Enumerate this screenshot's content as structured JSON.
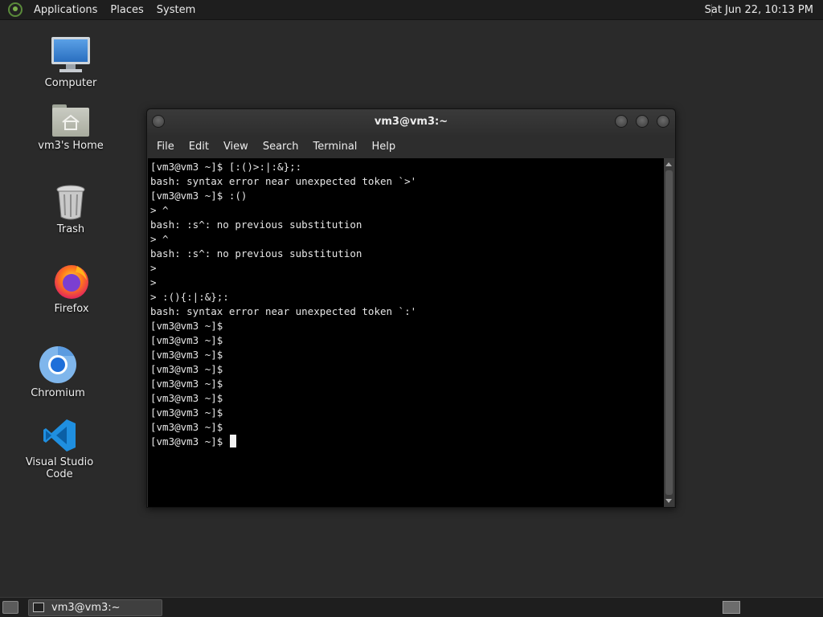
{
  "top_panel": {
    "menus": [
      "Applications",
      "Places",
      "System"
    ],
    "clock": "Sat Jun 22, 10:13 PM"
  },
  "desktop_icons": [
    {
      "label": "Computer",
      "icon": "computer-icon"
    },
    {
      "label": "vm3's Home",
      "icon": "home-folder-icon"
    },
    {
      "label": "Trash",
      "icon": "trash-icon"
    },
    {
      "label": "Firefox",
      "icon": "firefox-icon"
    },
    {
      "label": "Chromium",
      "icon": "chromium-icon"
    },
    {
      "label": "Visual Studio Code",
      "icon": "vscode-icon"
    }
  ],
  "terminal": {
    "title": "vm3@vm3:~",
    "menu": [
      "File",
      "Edit",
      "View",
      "Search",
      "Terminal",
      "Help"
    ],
    "lines": [
      "[vm3@vm3 ~]$ [:()>:|:&};:",
      "bash: syntax error near unexpected token `>'",
      "[vm3@vm3 ~]$ :()",
      "> ^",
      "bash: :s^: no previous substitution",
      "> ^",
      "bash: :s^: no previous substitution",
      ">",
      ">",
      "> :(){:|:&};:",
      "bash: syntax error near unexpected token `:'",
      "[vm3@vm3 ~]$",
      "[vm3@vm3 ~]$",
      "[vm3@vm3 ~]$",
      "[vm3@vm3 ~]$",
      "[vm3@vm3 ~]$",
      "[vm3@vm3 ~]$",
      "[vm3@vm3 ~]$",
      "[vm3@vm3 ~]$",
      "[vm3@vm3 ~]$ "
    ]
  },
  "taskbar": {
    "task_label": "vm3@vm3:~"
  }
}
